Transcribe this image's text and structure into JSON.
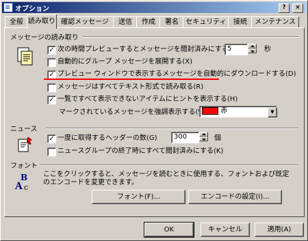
{
  "window": {
    "title": "オプション",
    "minimize_label": "_",
    "close_label": "×"
  },
  "tabs": [
    {
      "label": "全般"
    },
    {
      "label": "読み取り"
    },
    {
      "label": "確認メッセージ"
    },
    {
      "label": "送信"
    },
    {
      "label": "作成"
    },
    {
      "label": "署名"
    },
    {
      "label": "セキュリティ"
    },
    {
      "label": "接続"
    },
    {
      "label": "メンテナンス"
    }
  ],
  "reading": {
    "group_title": "メッセージの読み取り",
    "preview_mark": {
      "label": "次の時間プレビューするとメッセージを閲封済みにする(M)",
      "checked": true,
      "value": "5",
      "unit": "秒"
    },
    "auto_expand": {
      "label": "自動的にグループ メッセージを展開する(X)",
      "checked": false
    },
    "auto_download": {
      "label": "プレビュー ウィンドウで表示するメッセージを自動的にダウンロードする(D)",
      "checked": true
    },
    "plain_text": {
      "label": "メッセージはすべてテキスト形式で読み取る(R)",
      "checked": false
    },
    "show_tooltips": {
      "label": "一覧ですべて表示できないアイテムにヒントを表示する(H)",
      "checked": true
    },
    "highlight_label": "マークされているメッセージを強調表示する(W):",
    "highlight_color": {
      "name": "赤",
      "swatch": "#ff0000"
    },
    "highlight_color_dropdown": "▼"
  },
  "news": {
    "group_title": "ニュース",
    "headers_at_once": {
      "label": "一度に取得するヘッダーの数(G)",
      "checked": true,
      "value": "300",
      "unit": "個"
    },
    "mark_all_read": {
      "label": "ニュースグループの終了時にすべて閲封済みにする(K)",
      "checked": false
    }
  },
  "fonts": {
    "group_title": "フォント",
    "description": "ここをクリックすると、メッセージを読むときに使用する、フォントおよび既定のエンコードを変更できます。",
    "font_button": "フォント(F)...",
    "encoding_button": "エンコードの設定(I)..."
  },
  "footer": {
    "ok": "OK",
    "cancel": "キャンセル",
    "apply": "適用(A)"
  },
  "colors": {
    "annotation_underline": "#ff0000",
    "titlebar": "#0a246a"
  }
}
